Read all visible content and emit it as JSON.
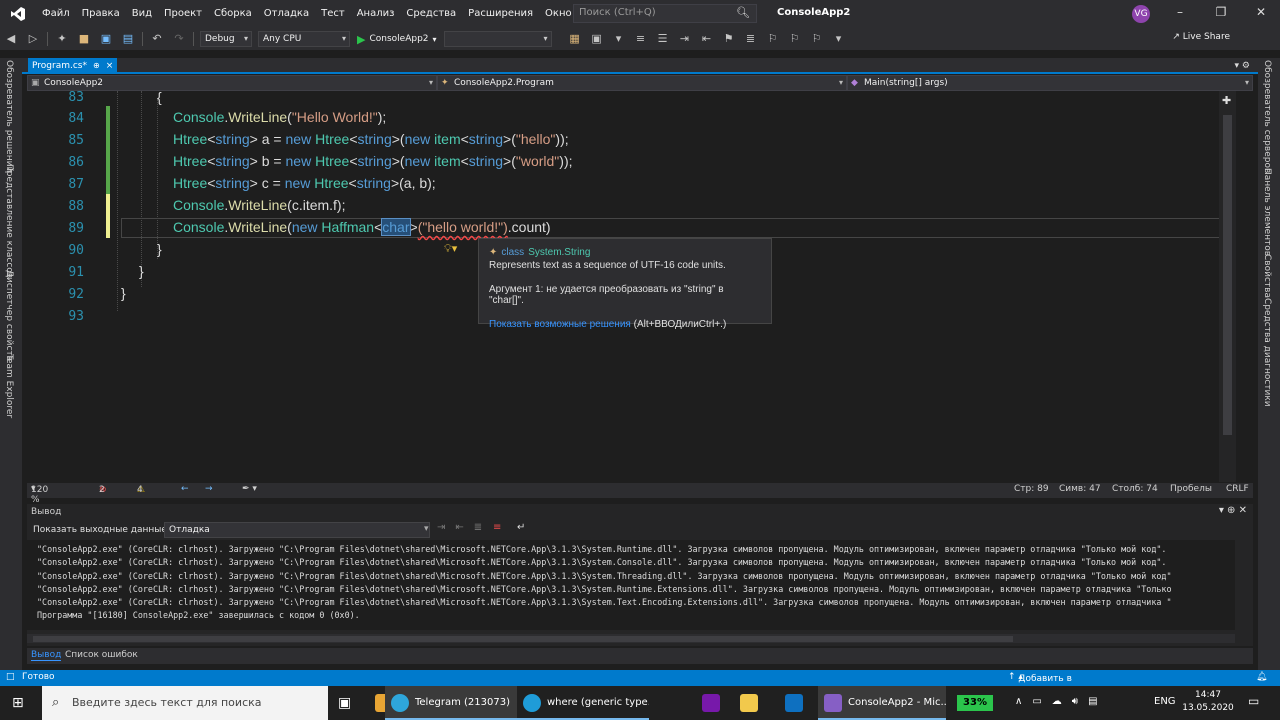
{
  "menu": {
    "items": [
      "Файл",
      "Правка",
      "Вид",
      "Проект",
      "Сборка",
      "Отладка",
      "Тест",
      "Анализ",
      "Средства",
      "Расширения",
      "Окно",
      "Справка"
    ],
    "search_placeholder": "Поиск (Ctrl+Q)",
    "solution_name": "ConsoleApp2",
    "user_initials": "VG"
  },
  "toolbar": {
    "config": "Debug",
    "platform": "Any CPU",
    "run_label": "ConsoleApp2",
    "live_share": "Live Share"
  },
  "left_tabs": [
    "Обозреватель решений",
    "Представление классов",
    "Диспетчер свойств",
    "Team Explorer"
  ],
  "right_tabs": [
    "Обозреватель серверов",
    "Панель элементов",
    "Свойства",
    "Средства диагностики"
  ],
  "document_tab": {
    "label": "Program.cs*",
    "close": "×"
  },
  "navbar": {
    "project": "ConsoleApp2",
    "type": "ConsoleApp2.Program",
    "member": "Main(string[] args)"
  },
  "editor": {
    "line_numbers": [
      "83",
      "84",
      "85",
      "86",
      "87",
      "88",
      "89",
      "90",
      "91",
      "92",
      "93"
    ],
    "lines": {
      "l83": "{",
      "l90": "}",
      "l91": "}",
      "l92": "}"
    },
    "tokens": {
      "console": "Console",
      "writeline": "WriteLine",
      "hello_world": "\"Hello World!\"",
      "htree": "Htree",
      "string": "string",
      "new": "new",
      "item": "item",
      "hello": "\"hello\"",
      "world": "\"world\"",
      "a": "a",
      "b": "b",
      "c": "c",
      "cargs": "(a, b);",
      "citemf": "(c.item.f);",
      "haffman": "Haffman",
      "char": "char",
      "hello_world2": "(\"hello world!\")",
      "count": ".count)"
    }
  },
  "quick_info": {
    "kind": "class",
    "type": "System.String",
    "description": "Represents text as a sequence of UTF-16 code units.",
    "error": "Аргумент 1: не удается преобразовать из \"string\" в \"char[]\".",
    "fix_link": "Показать возможные решения",
    "fix_shortcut": "(Alt+ВВОДилиCtrl+.)"
  },
  "editor_status": {
    "zoom": "120 %",
    "errors": "2",
    "warnings": "4",
    "line": "Стр: 89",
    "char": "Симв: 47",
    "col": "Столб: 74",
    "ws": "Пробелы",
    "eol": "CRLF"
  },
  "output": {
    "title": "Вывод",
    "source_label": "Показать выходные данные из:",
    "source": "Отладка",
    "lines": [
      "\"ConsoleApp2.exe\" (CoreCLR: clrhost). Загружено \"C:\\Program Files\\dotnet\\shared\\Microsoft.NETCore.App\\3.1.3\\System.Runtime.dll\". Загрузка символов пропущена. Модуль оптимизирован, включен параметр отладчика \"Только мой код\".",
      "\"ConsoleApp2.exe\" (CoreCLR: clrhost). Загружено \"C:\\Program Files\\dotnet\\shared\\Microsoft.NETCore.App\\3.1.3\\System.Console.dll\". Загрузка символов пропущена. Модуль оптимизирован, включен параметр отладчика \"Только мой код\".",
      "\"ConsoleApp2.exe\" (CoreCLR: clrhost). Загружено \"C:\\Program Files\\dotnet\\shared\\Microsoft.NETCore.App\\3.1.3\\System.Threading.dll\". Загрузка символов пропущена. Модуль оптимизирован, включен параметр отладчика \"Только мой код\"",
      "\"ConsoleApp2.exe\" (CoreCLR: clrhost). Загружено \"C:\\Program Files\\dotnet\\shared\\Microsoft.NETCore.App\\3.1.3\\System.Runtime.Extensions.dll\". Загрузка символов пропущена. Модуль оптимизирован, включен параметр отладчика \"Только",
      "\"ConsoleApp2.exe\" (CoreCLR: clrhost). Загружено \"C:\\Program Files\\dotnet\\shared\\Microsoft.NETCore.App\\3.1.3\\System.Text.Encoding.Extensions.dll\". Загрузка символов пропущена. Модуль оптимизирован, включен параметр отладчика \"",
      "Программа \"[16180] ConsoleApp2.exe\" завершилась с кодом 0 (0x0)."
    ]
  },
  "bottom_tabs": [
    "Вывод",
    "Список ошибок"
  ],
  "statusbar": {
    "ready": "Готово",
    "source_control": "Добавить в систему управления версиями"
  },
  "taskbar": {
    "search_placeholder": "Введите здесь текст для поиска",
    "telegram": "Telegram (213073)",
    "edge": "where (generic type...",
    "vs": "ConsoleApp2 - Mic...",
    "battery": "33%",
    "lang": "ENG",
    "time": "14:47",
    "date": "13.05.2020"
  }
}
